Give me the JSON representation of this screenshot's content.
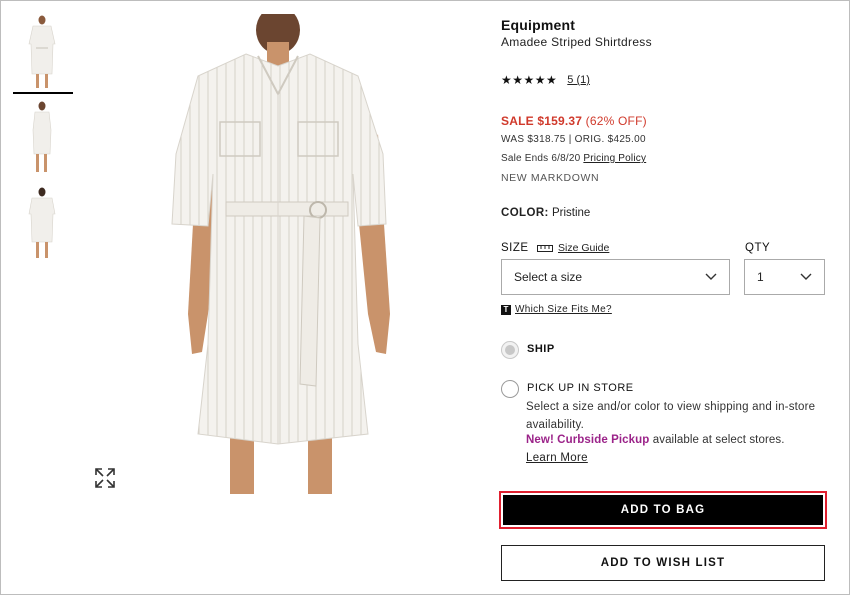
{
  "product": {
    "brand": "Equipment",
    "name": "Amadee Striped Shirtdress",
    "stars": "★★★★★",
    "rating_link": "5 (1)"
  },
  "pricing": {
    "sale_prefix": "SALE ",
    "sale_price": "$159.37",
    "sale_off": " (62% OFF)",
    "was": "WAS $318.75 | ORIG. $425.00",
    "sale_ends": "Sale Ends 6/8/20 ",
    "pricing_policy": "Pricing Policy",
    "markdown": "NEW MARKDOWN"
  },
  "color": {
    "label": "COLOR:",
    "value": " Pristine"
  },
  "size": {
    "label": "SIZE",
    "guide": "Size Guide",
    "selected": "Select a size",
    "fits_link": "Which Size Fits Me?"
  },
  "qty": {
    "label": "QTY",
    "selected": "1"
  },
  "fulfillment": {
    "ship_label": "SHIP",
    "pickup_label": "PICK UP IN STORE",
    "pickup_desc": "Select a size and/or color to view shipping and in-store availability.",
    "curbside_bold": "New! Curbside Pickup",
    "curbside_rest": " available at select stores.",
    "learn_more": "Learn More"
  },
  "buttons": {
    "add_to_bag": "ADD TO BAG",
    "add_to_wish_list": "ADD TO WISH LIST"
  },
  "colors": {
    "sale": "#d0392b",
    "curbside": "#9b2389",
    "bag_outline": "#e0202f",
    "button_bg": "#000000"
  },
  "icons": [
    "expand-icon",
    "chevron-down-icon",
    "ruler-icon",
    "t-info-icon"
  ]
}
